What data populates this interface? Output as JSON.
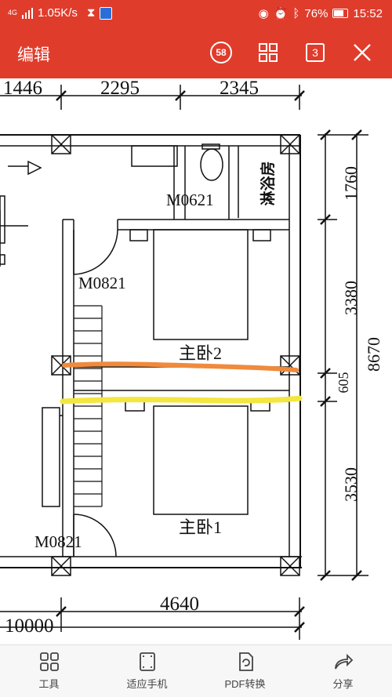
{
  "status": {
    "network": "4G",
    "speed": "1.05K/s",
    "battery": "76%",
    "time": "15:52"
  },
  "appbar": {
    "title": "编辑",
    "badge_58": "58",
    "page_count": "3"
  },
  "drawing": {
    "dims_top": [
      "1446",
      "2295",
      "2345"
    ],
    "dims_right": [
      "1760",
      "3380",
      "605",
      "3530"
    ],
    "dim_total_right": "8670",
    "dim_bottom": "4640",
    "dim_total_bottom": "10000",
    "door_m0621": "M0621",
    "door_m0821_top": "M0821",
    "door_m0821_bottom": "M0821",
    "shower": "淋浴房",
    "bedroom2": "主卧2",
    "bedroom1": "主卧1"
  },
  "toolbar": {
    "tools": "工具",
    "fit_phone": "适应手机",
    "pdf_convert": "PDF转换",
    "share": "分享"
  },
  "colors": {
    "appbar": "#e03c2c",
    "orange_stroke": "#f08a3c",
    "yellow_stroke": "#f3e640"
  }
}
